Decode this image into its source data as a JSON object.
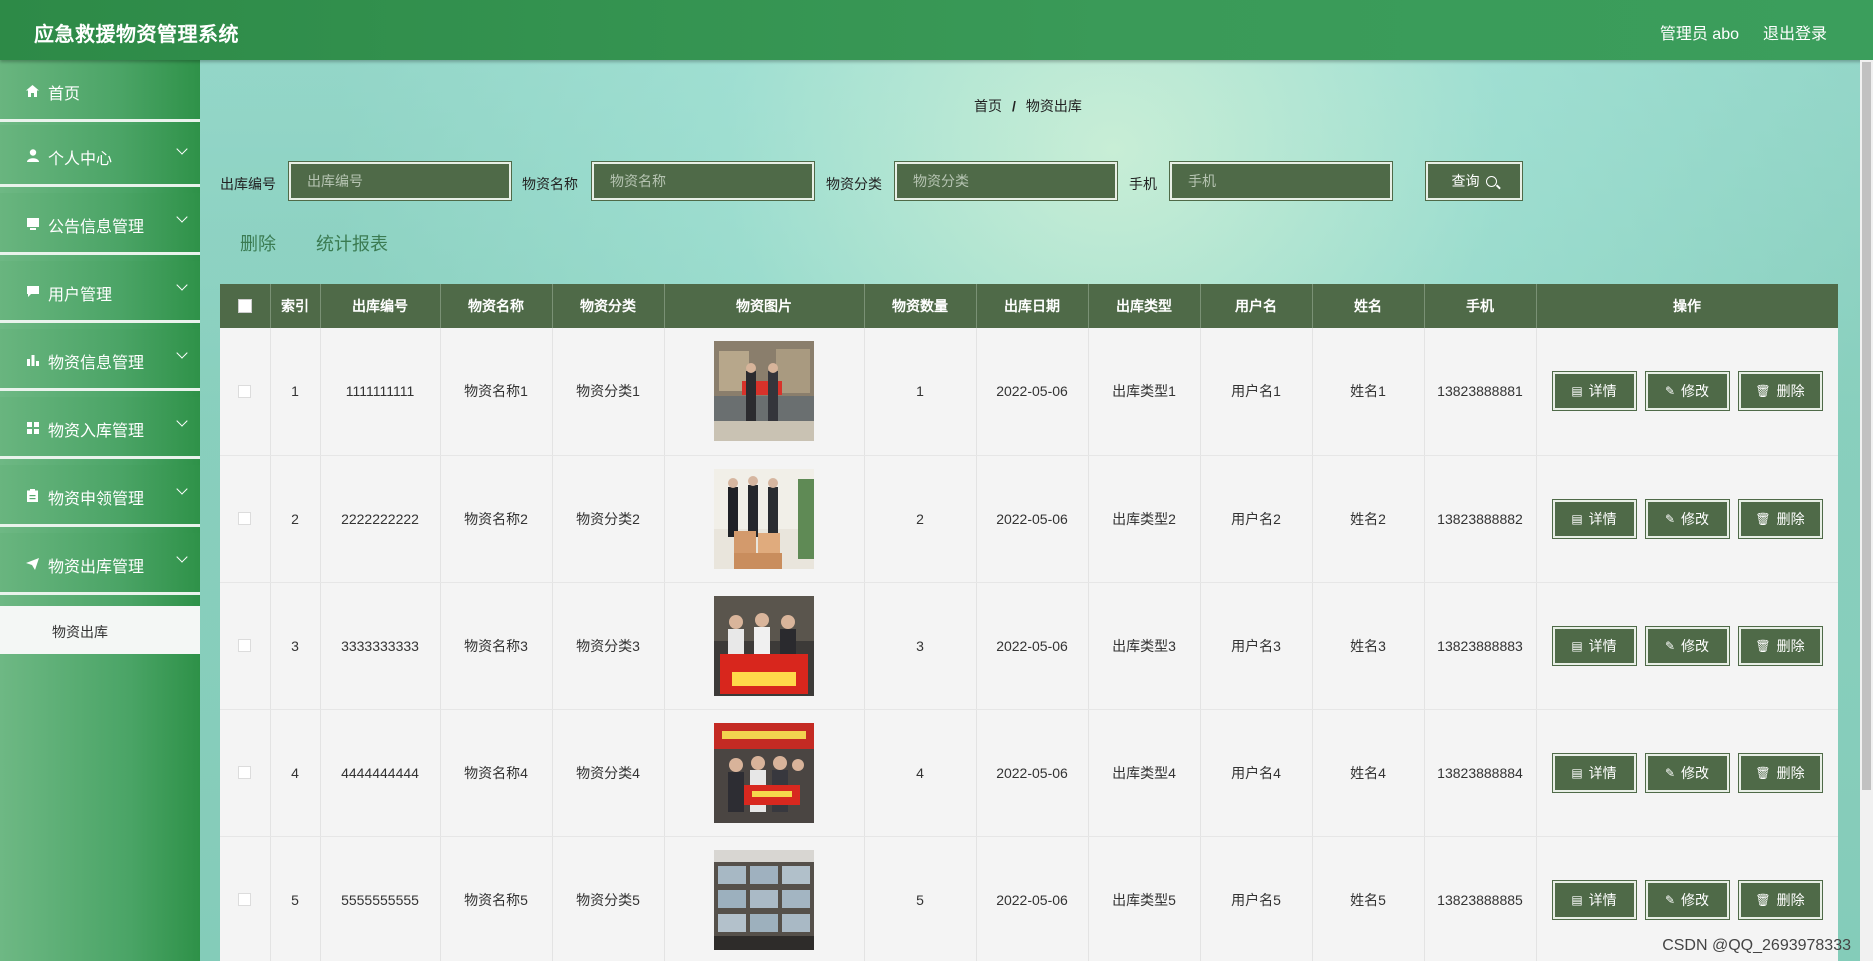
{
  "header": {
    "title": "应急救援物资管理系统",
    "user": "管理员 abo",
    "logout": "退出登录"
  },
  "sidebar": {
    "items": [
      {
        "label": "首页",
        "icon": "home-icon"
      },
      {
        "label": "个人中心",
        "icon": "user-icon"
      },
      {
        "label": "公告信息管理",
        "icon": "notice-icon"
      },
      {
        "label": "用户管理",
        "icon": "chat-icon"
      },
      {
        "label": "物资信息管理",
        "icon": "chart-icon"
      },
      {
        "label": "物资入库管理",
        "icon": "grid-icon"
      },
      {
        "label": "物资申领管理",
        "icon": "clipboard-icon"
      },
      {
        "label": "物资出库管理",
        "icon": "send-icon"
      }
    ],
    "submenu": "物资出库"
  },
  "breadcrumb": {
    "home": "首页",
    "sep": "/",
    "current": "物资出库"
  },
  "search": {
    "fields": [
      {
        "label": "出库编号",
        "placeholder": "出库编号"
      },
      {
        "label": "物资名称",
        "placeholder": "物资名称"
      },
      {
        "label": "物资分类",
        "placeholder": "物资分类"
      },
      {
        "label": "手机",
        "placeholder": "手机"
      }
    ],
    "button": "查询"
  },
  "actions": {
    "delete": "删除",
    "report": "统计报表"
  },
  "table": {
    "headers": [
      "索引",
      "出库编号",
      "物资名称",
      "物资分类",
      "物资图片",
      "物资数量",
      "出库日期",
      "出库类型",
      "用户名",
      "姓名",
      "手机",
      "操作"
    ],
    "buttons": {
      "detail": "详情",
      "edit": "修改",
      "delete": "删除"
    },
    "rows": [
      {
        "index": "1",
        "code": "1111111111",
        "name": "物资名称1",
        "category": "物资分类1",
        "qty": "1",
        "date": "2022-05-06",
        "type": "出库类型1",
        "username": "用户名1",
        "realname": "姓名1",
        "phone": "13823888881"
      },
      {
        "index": "2",
        "code": "2222222222",
        "name": "物资名称2",
        "category": "物资分类2",
        "qty": "2",
        "date": "2022-05-06",
        "type": "出库类型2",
        "username": "用户名2",
        "realname": "姓名2",
        "phone": "13823888882"
      },
      {
        "index": "3",
        "code": "3333333333",
        "name": "物资名称3",
        "category": "物资分类3",
        "qty": "3",
        "date": "2022-05-06",
        "type": "出库类型3",
        "username": "用户名3",
        "realname": "姓名3",
        "phone": "13823888883"
      },
      {
        "index": "4",
        "code": "4444444444",
        "name": "物资名称4",
        "category": "物资分类4",
        "qty": "4",
        "date": "2022-05-06",
        "type": "出库类型4",
        "username": "用户名4",
        "realname": "姓名4",
        "phone": "13823888884"
      },
      {
        "index": "5",
        "code": "5555555555",
        "name": "物资名称5",
        "category": "物资分类5",
        "qty": "5",
        "date": "2022-05-06",
        "type": "出库类型5",
        "username": "用户名5",
        "realname": "姓名5",
        "phone": "13823888885"
      }
    ]
  },
  "watermark": "CSDN @QQ_2693978333",
  "colors": {
    "header": "#2d8a47",
    "table_header": "#4f6a48",
    "button": "#4f6a48",
    "link": "#3b7b52"
  }
}
